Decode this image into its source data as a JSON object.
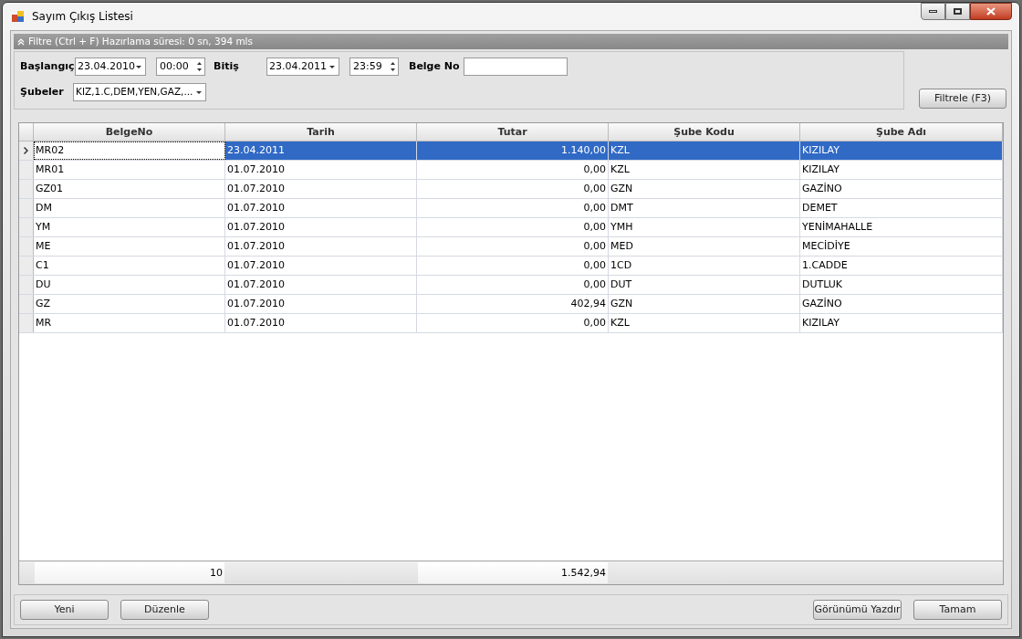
{
  "window": {
    "title": "Sayım Çıkış Listesi"
  },
  "filter": {
    "header": "Filtre (Ctrl + F) Hazırlama süresi: 0 sn, 394 mls",
    "expanded": true,
    "start_label": "Başlangıç",
    "start_date": "23.04.2010",
    "start_time": "00:00",
    "end_label": "Bitiş",
    "end_date": "23.04.2011",
    "end_time": "23:59",
    "doc_label": "Belge No",
    "branches_label": "Şubeler",
    "branches_value": "KIZ,1.C,DEM,YEN,GAZ,...",
    "filter_button": "Filtrele (F3)"
  },
  "table": {
    "columns": [
      "BelgeNo",
      "Tarih",
      "Tutar",
      "Şube Kodu",
      "Şube Adı"
    ],
    "rows": [
      {
        "cells": [
          "MR02",
          "23.04.2011",
          "1.140,00",
          "KZL",
          "KIZILAY"
        ],
        "selected": true
      },
      {
        "cells": [
          "MR01",
          "01.07.2010",
          "0,00",
          "KZL",
          "KIZILAY"
        ],
        "selected": false
      },
      {
        "cells": [
          "GZ01",
          "01.07.2010",
          "0,00",
          "GZN",
          "GAZİNO"
        ],
        "selected": false
      },
      {
        "cells": [
          "DM",
          "01.07.2010",
          "0,00",
          "DMT",
          "DEMET"
        ],
        "selected": false
      },
      {
        "cells": [
          "YM",
          "01.07.2010",
          "0,00",
          "YMH",
          "YENİMAHALLE"
        ],
        "selected": false
      },
      {
        "cells": [
          "ME",
          "01.07.2010",
          "0,00",
          "MED",
          "MECİDİYE"
        ],
        "selected": false
      },
      {
        "cells": [
          "C1",
          "01.07.2010",
          "0,00",
          "1CD",
          "1.CADDE"
        ],
        "selected": false
      },
      {
        "cells": [
          "DU",
          "01.07.2010",
          "0,00",
          "DUT",
          "DUTLUK"
        ],
        "selected": false
      },
      {
        "cells": [
          "GZ",
          "01.07.2010",
          "402,94",
          "GZN",
          "GAZİNO"
        ],
        "selected": false
      },
      {
        "cells": [
          "MR",
          "01.07.2010",
          "0,00",
          "KZL",
          "KIZILAY"
        ],
        "selected": false
      }
    ],
    "summary": {
      "count": "10",
      "total": "1.542,94"
    }
  },
  "buttons_left": [
    "Yeni",
    "Düzenle"
  ],
  "buttons_right": [
    "Görünümü Yazdır",
    "Tamam"
  ]
}
